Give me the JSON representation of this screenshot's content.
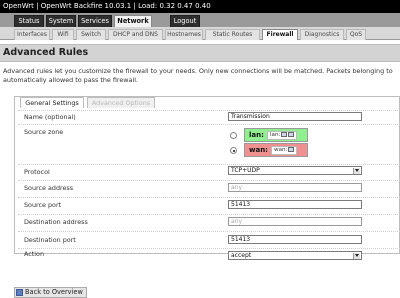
{
  "header": {
    "text": "OpenWrt | OpenWrt Backfire 10.03.1 | Load: 0.32 0.47 0.40"
  },
  "main_tabs": [
    {
      "label": "Status"
    },
    {
      "label": "System"
    },
    {
      "label": "Services"
    },
    {
      "label": "Network",
      "active": true
    },
    {
      "label": "Logout"
    }
  ],
  "sub_tabs": [
    {
      "label": "Interfaces"
    },
    {
      "label": "Wifi"
    },
    {
      "label": "Switch"
    },
    {
      "label": "DHCP and DNS"
    },
    {
      "label": "Hostnames"
    },
    {
      "label": "Static Routes"
    },
    {
      "label": "Firewall",
      "active": true
    },
    {
      "label": "Diagnostics"
    },
    {
      "label": "QoS"
    }
  ],
  "page": {
    "title": "Advanced Rules",
    "description_line1": "Advanced rules let you customize the firewall to your needs. Only new connections will be matched. Packets belonging to",
    "description_line2": "automatically allowed to pass the firewall."
  },
  "section_tabs": {
    "general": "General Settings",
    "advanced": "Advanced Options"
  },
  "form": {
    "name": {
      "label": "Name (optional)",
      "value": "Transmission"
    },
    "source_zone": {
      "label": "Source zone",
      "zones": [
        {
          "name": "lan:",
          "network": "lan:",
          "color": "#90f090",
          "selected": false
        },
        {
          "name": "wan:",
          "network": "wan:",
          "color": "#f09090",
          "selected": true
        }
      ]
    },
    "protocol": {
      "label": "Protocol",
      "value": "TCP+UDP"
    },
    "source_address": {
      "label": "Source address",
      "placeholder": "any"
    },
    "source_port": {
      "label": "Source port",
      "value": "51413"
    },
    "destination_address": {
      "label": "Destination address",
      "placeholder": "any"
    },
    "destination_port": {
      "label": "Destination port",
      "value": "51413"
    },
    "action": {
      "label": "Action",
      "value": "accept"
    }
  },
  "footer": {
    "back_label": "Back to Overview"
  },
  "icons": {
    "network": "network-icon",
    "back": "back-arrow-icon"
  }
}
